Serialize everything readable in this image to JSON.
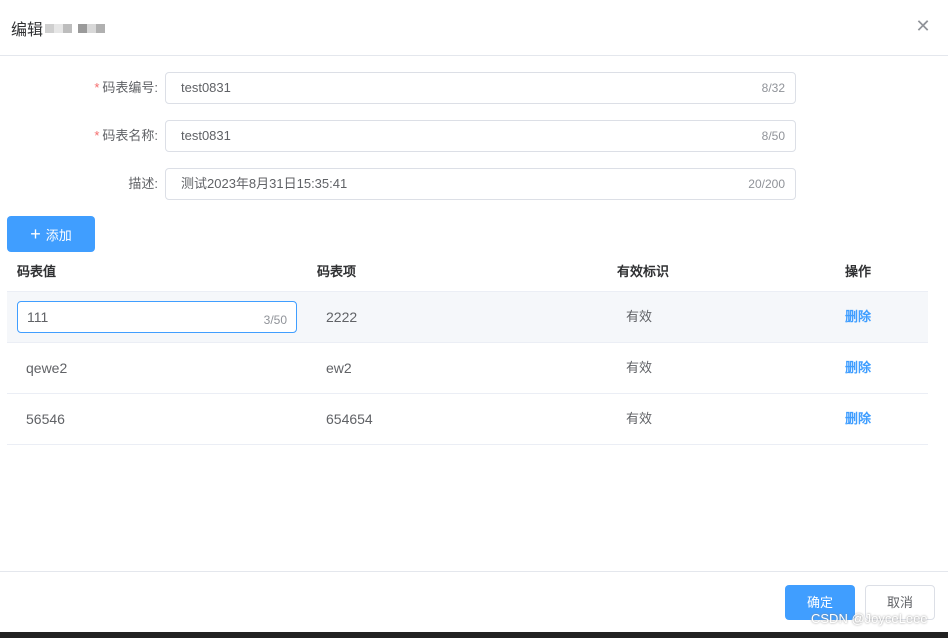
{
  "dialog": {
    "title": "编辑",
    "close_glyph": "✕"
  },
  "form": {
    "code": {
      "label": "码表编号:",
      "value": "test0831",
      "counter": "8/32",
      "required": true
    },
    "name": {
      "label": "码表名称:",
      "value": "test0831",
      "counter": "8/50",
      "required": true
    },
    "desc": {
      "label": "描述:",
      "value": "测试2023年8月31日15:35:41",
      "counter": "20/200",
      "required": false
    }
  },
  "add_button": {
    "icon": "plus-icon",
    "label": "添加"
  },
  "table": {
    "columns": [
      "码表值",
      "码表项",
      "有效标识",
      "操作"
    ],
    "rows": [
      {
        "value": "111",
        "counter": "3/50",
        "item": "2222",
        "status": "有效",
        "action": "删除"
      },
      {
        "value": "qewe2",
        "item": "ew2",
        "status": "有效",
        "action": "删除"
      },
      {
        "value": "56546",
        "item": "654654",
        "status": "有效",
        "action": "删除"
      }
    ]
  },
  "footer": {
    "ok_label": "确定",
    "cancel_label": "取消"
  },
  "watermark": "CSDN @JoyceLeee",
  "colors": {
    "primary": "#409eff",
    "required": "#f56c6c"
  }
}
